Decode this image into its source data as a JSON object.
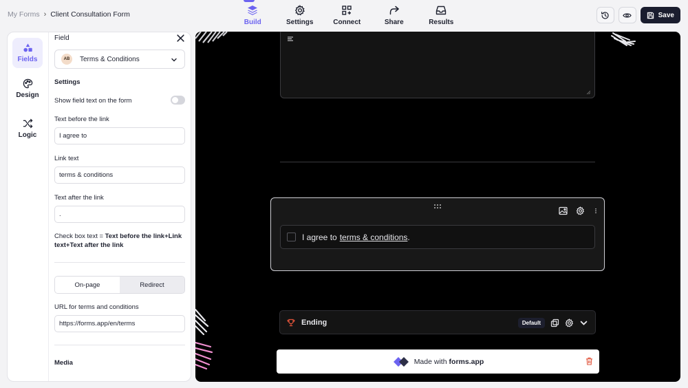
{
  "breadcrumb": {
    "root": "My Forms",
    "separator": "›",
    "current": "Client Consultation Form"
  },
  "nav": [
    {
      "label": "Build",
      "icon": "layers-icon",
      "active": true
    },
    {
      "label": "Settings",
      "icon": "gear-icon",
      "active": false
    },
    {
      "label": "Connect",
      "icon": "connect-icon",
      "active": false
    },
    {
      "label": "Share",
      "icon": "share-icon",
      "active": false
    },
    {
      "label": "Results",
      "icon": "inbox-icon",
      "active": false
    }
  ],
  "toolbar": {
    "history_icon": "history-icon",
    "preview_icon": "eye-icon",
    "save_label": "Save"
  },
  "sidebar": {
    "items": [
      {
        "label": "Fields",
        "icon": "shapes-icon",
        "active": true
      },
      {
        "label": "Design",
        "icon": "palette-icon",
        "active": false
      },
      {
        "label": "Logic",
        "icon": "shuffle-icon",
        "active": false
      }
    ]
  },
  "field_panel": {
    "title": "Field",
    "field_type": {
      "icon_text": "AB",
      "value": "Terms & Conditions"
    },
    "settings_heading": "Settings",
    "show_field_text_label": "Show field text on the form",
    "show_field_text_on": false,
    "text_before_label": "Text before the link",
    "text_before_value": "I agree to",
    "link_text_label": "Link text",
    "link_text_value": "terms & conditions",
    "text_after_label": "Text after the link",
    "text_after_value": ".",
    "note_prefix": "Check box text = ",
    "note_bold": "Text before the link+Link text+Text after the link",
    "link_mode": {
      "options": [
        "On-page",
        "Redirect"
      ],
      "selected": "Redirect"
    },
    "url_label": "URL for terms and conditions",
    "url_value": "https://forms.app/en/terms",
    "media_heading": "Media"
  },
  "canvas": {
    "checkbox_text_before": "I agree to",
    "checkbox_link": "terms & conditions",
    "checkbox_text_after": ".",
    "ending_label": "Ending",
    "ending_badge": "Default",
    "made_with_prefix": "Made with",
    "made_with_brand": "forms.app"
  },
  "colors": {
    "accent": "#6c63f0",
    "dark_button": "#1a1d2e",
    "canvas_bg": "#000000",
    "decor_pink": "#f08fd0"
  }
}
